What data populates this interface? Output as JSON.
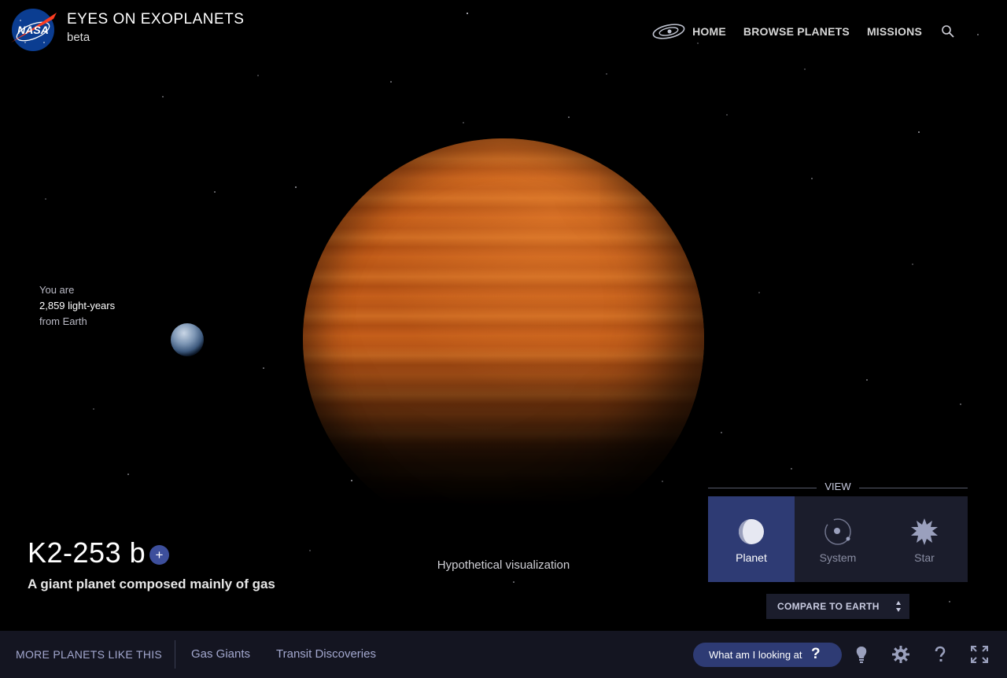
{
  "header": {
    "title": "EYES ON EXOPLANETS",
    "subtitle": "beta",
    "nav": [
      "HOME",
      "BROWSE PLANETS",
      "MISSIONS"
    ],
    "logo_text": "NASA"
  },
  "distance": {
    "line1": "You are",
    "value": "2,859 light-years",
    "line3": "from Earth"
  },
  "planet": {
    "name": "K2-253 b",
    "add_symbol": "+",
    "description": "A giant planet composed mainly of gas",
    "visualization_note": "Hypothetical visualization"
  },
  "view": {
    "label": "VIEW",
    "options": [
      "Planet",
      "System",
      "Star"
    ],
    "selected": "Planet",
    "compare_label": "COMPARE TO EARTH"
  },
  "footer": {
    "more_label": "MORE PLANETS LIKE THIS",
    "links": [
      "Gas Giants",
      "Transit Discoveries"
    ],
    "looking_label": "What am I looking at",
    "looking_symbol": "?"
  },
  "colors": {
    "accent": "#2e3b74",
    "panel": "#1b1d2c",
    "footer": "#141521",
    "link": "#a3a8cf",
    "planet": "#c05a18"
  },
  "icons": [
    "galaxy-icon",
    "search-icon",
    "planet-icon",
    "system-icon",
    "star-icon",
    "sort-arrows-icon",
    "lightbulb-icon",
    "gear-icon",
    "help-icon",
    "fullscreen-icon"
  ]
}
